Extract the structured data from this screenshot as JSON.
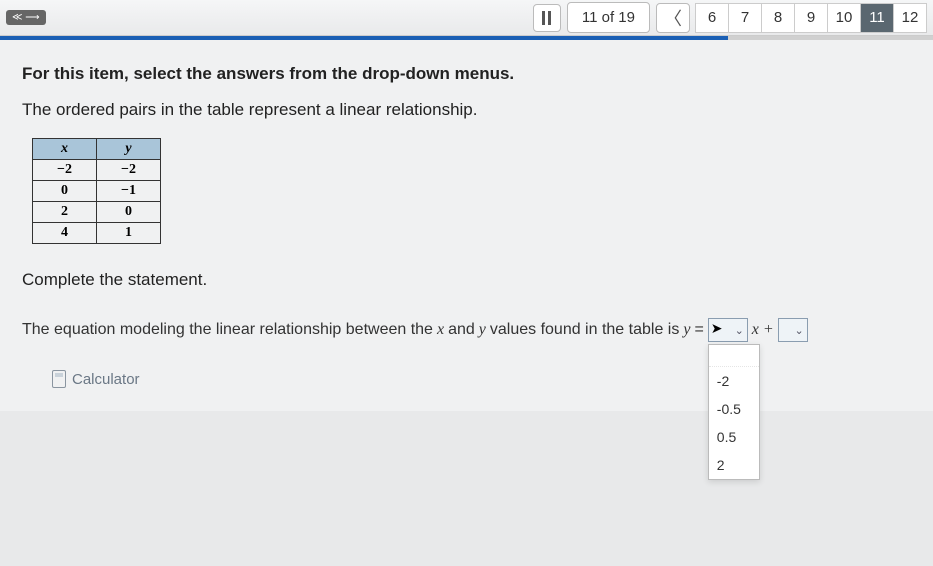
{
  "topbar": {
    "chip": "≪ ⟶",
    "page_count": "11 of 19",
    "prev": "〈",
    "qnav": [
      {
        "label": "6",
        "current": false
      },
      {
        "label": "7",
        "current": false
      },
      {
        "label": "8",
        "current": false
      },
      {
        "label": "9",
        "current": false
      },
      {
        "label": "10",
        "current": false
      },
      {
        "label": "11",
        "current": true
      },
      {
        "label": "12",
        "current": false
      }
    ]
  },
  "question": {
    "instruction": "For this item, select the answers from the drop-down menus.",
    "description": "The ordered pairs in the table represent a linear relationship.",
    "table": {
      "headers": {
        "x": "x",
        "y": "y"
      },
      "rows": [
        {
          "x": "−2",
          "y": "−2"
        },
        {
          "x": "0",
          "y": "−1"
        },
        {
          "x": "2",
          "y": "0"
        },
        {
          "x": "4",
          "y": "1"
        }
      ]
    },
    "complete": "Complete the statement.",
    "eq_pre": "The equation modeling the linear relationship between the ",
    "eq_and": " and ",
    "eq_mid": " values found in the table is ",
    "eq_yeq": " =",
    "var_x": "x",
    "var_y": "y",
    "plus": "x +",
    "dropdown_caret": "⌄",
    "dropdown_options": [
      "-2",
      "-0.5",
      "0.5",
      "2"
    ]
  },
  "tools": {
    "calculator": "Calculator"
  }
}
